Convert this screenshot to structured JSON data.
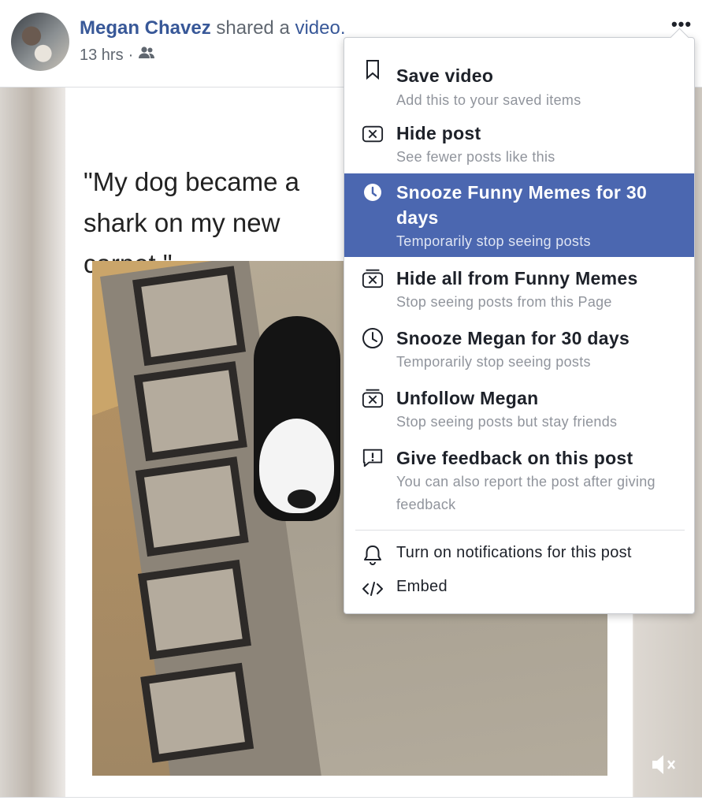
{
  "post": {
    "author_name": "Megan Chavez",
    "action_text": " shared a ",
    "object_link": "video.",
    "time": "13 hrs",
    "separator": "·",
    "audience_icon": "friends-icon",
    "more_label": "•••"
  },
  "video": {
    "caption": "\"My dog became a shark on my new carpet.\"",
    "mute_icon": "mute-icon"
  },
  "menu": {
    "items": [
      {
        "title": "Save video",
        "subtitle": "Add this to your saved items",
        "icon": "bookmark-icon"
      },
      {
        "title": "Hide post",
        "subtitle": "See fewer posts like this",
        "icon": "hide-x-icon"
      },
      {
        "title": "Snooze Funny Memes for 30 days",
        "subtitle": "Temporarily stop seeing posts",
        "icon": "clock-icon"
      },
      {
        "title": "Hide all from Funny Memes",
        "subtitle": "Stop seeing posts from this Page",
        "icon": "hide-all-icon"
      },
      {
        "title": "Snooze Megan for 30 days",
        "subtitle": "Temporarily stop seeing posts",
        "icon": "clock-outline-icon"
      },
      {
        "title": "Unfollow Megan",
        "subtitle": "Stop seeing posts but stay friends",
        "icon": "unfollow-icon"
      },
      {
        "title": "Give feedback on this post",
        "subtitle": "You can also report the post after giving feedback",
        "icon": "feedback-icon"
      }
    ],
    "secondary": [
      {
        "label": "Turn on notifications for this post",
        "icon": "bell-icon"
      },
      {
        "label": "Embed",
        "icon": "code-icon"
      }
    ]
  },
  "colors": {
    "link": "#385898",
    "highlight": "#4b67b0"
  }
}
